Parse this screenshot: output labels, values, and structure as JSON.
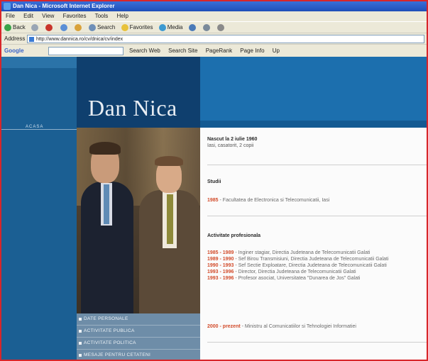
{
  "window": {
    "title": "Dan Nica - Microsoft Internet Explorer"
  },
  "menubar": [
    "File",
    "Edit",
    "View",
    "Favorites",
    "Tools",
    "Help"
  ],
  "toolbar": [
    "Back",
    "Search",
    "Favorites",
    "Media"
  ],
  "address": {
    "label": "Address",
    "url": "http://www.dannica.ro/cv/dnica/cv/index"
  },
  "google": {
    "logo": "Google",
    "buttons": [
      "Search Web",
      "Search Site",
      "PageRank",
      "Page Info",
      "Up"
    ]
  },
  "site": {
    "name": "Dan Nica",
    "nav_mini": "ACASA",
    "side_menu": [
      "DATE PERSONALE",
      "ACTIVITATE PUBLICA",
      "ACTIVITATE POLITICA",
      "MESAJE PENTRU CETATENI"
    ]
  },
  "content": {
    "birth_title": "Nascut la 2 iulie 1960",
    "birth_sub": "Iasi, casatorit, 2 copii",
    "studies_title": "Studii",
    "studies_year": "1985",
    "studies_text": "- Facultatea de Electronica si Telecomunicatii, Iasi",
    "prof_title": "Activitate profesionala",
    "prof_entries": [
      {
        "years": "1985 - 1989",
        "text": "- Inginer stagiar, Directia Judeteana de Telecomunicatii Galati"
      },
      {
        "years": "1989 - 1990",
        "text": "- Sef Birou Transmisiuni, Directia Judeteana de Telecomunicatii Galati"
      },
      {
        "years": "1990 - 1993",
        "text": "- Sef Sectie Exploatare, Directia Judeteana de Telecomunicatii Galati"
      },
      {
        "years": "1993 - 1996",
        "text": "- Director, Directia Judeteana de Telecomunicatii Galati"
      },
      {
        "years": "1993 - 1996",
        "text": "- Profesor asociat, Universitatea \"Dunarea de Jos\" Galati"
      }
    ],
    "last_line_years": "2000 - prezent",
    "last_line_text": "- Ministru al Comunicatiilor si Tehnologiei Informatiei"
  }
}
